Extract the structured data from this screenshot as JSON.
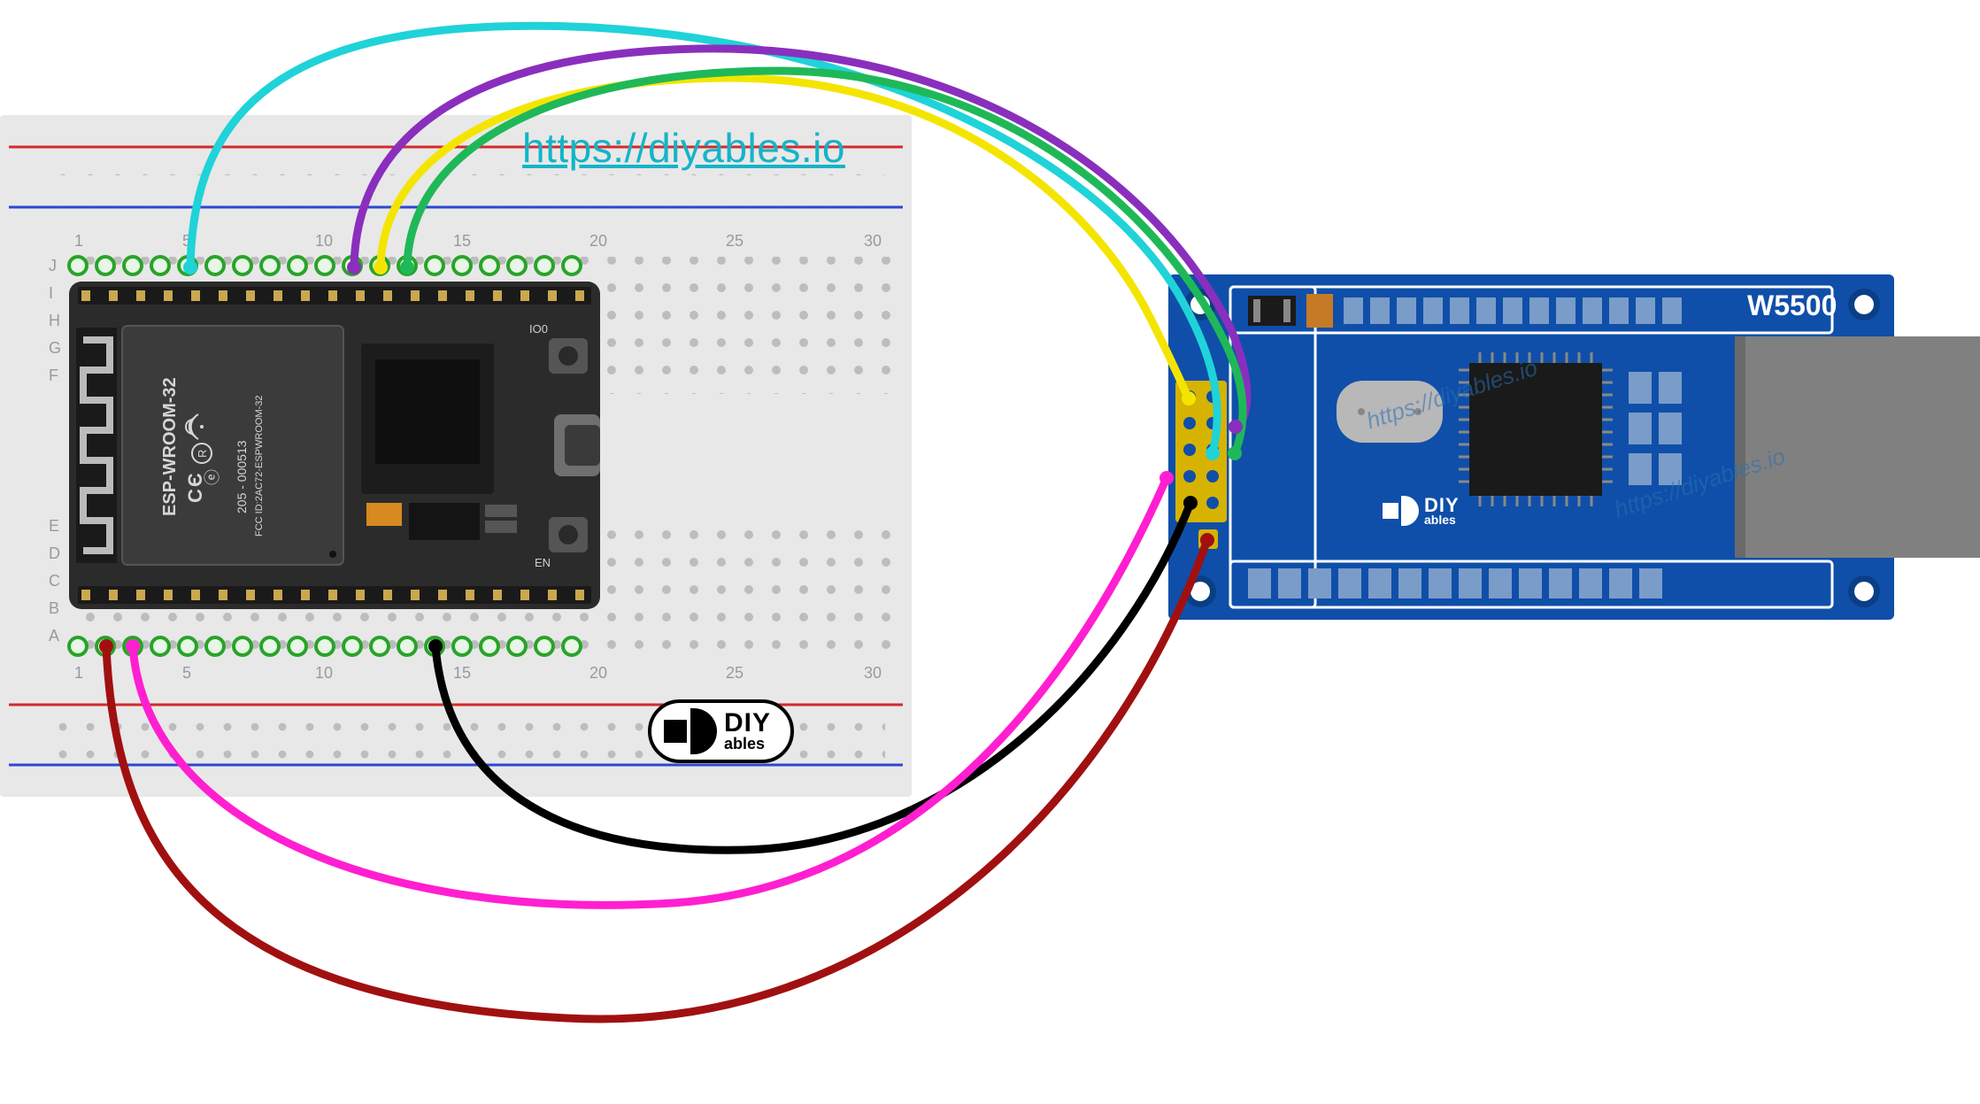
{
  "url": "https://diyables.io",
  "module_label": "W5500",
  "logo": {
    "big": "DIY",
    "small": "ables"
  },
  "esp32_label": "ESP-WROOM-32",
  "chip_marks": [
    "CE",
    "205 - 000513",
    "FCC ID:2AC72-ESPWROOM-32",
    "R"
  ],
  "breadboard": {
    "rail_numbers_top": [
      "1",
      "5",
      "10",
      "15",
      "20",
      "25",
      "30"
    ],
    "row_letters_left": [
      "A",
      "B",
      "C",
      "D",
      "E",
      "F",
      "G",
      "H",
      "I",
      "J"
    ]
  },
  "wires": [
    {
      "name": "cyan",
      "color": "#1fd3d8"
    },
    {
      "name": "purple",
      "color": "#8a2fbd"
    },
    {
      "name": "yellow",
      "color": "#f4e500"
    },
    {
      "name": "green",
      "color": "#1fb858"
    },
    {
      "name": "magenta",
      "color": "#ff1fd1"
    },
    {
      "name": "black",
      "color": "#000000"
    },
    {
      "name": "darkred",
      "color": "#a11010"
    }
  ],
  "watermark_text": "https://diyables.io"
}
